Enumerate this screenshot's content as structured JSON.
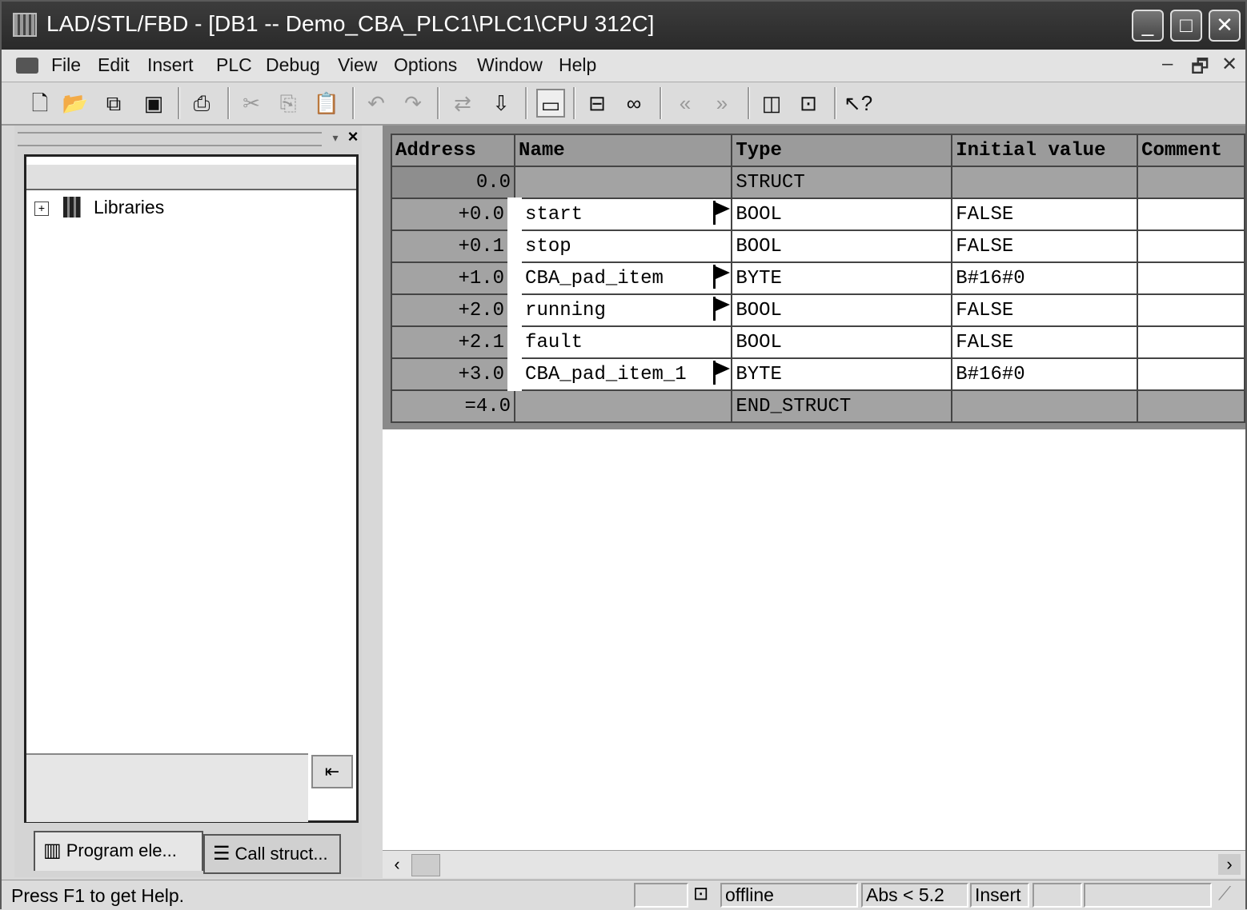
{
  "window": {
    "title": "LAD/STL/FBD  - [DB1 -- Demo_CBA_PLC1\\PLC1\\CPU 312C]",
    "controls": {
      "minimize": "_",
      "maximize": "□",
      "close": "✕"
    }
  },
  "menu": {
    "items": [
      "File",
      "Edit",
      "Insert",
      "PLC",
      "Debug",
      "View",
      "Options",
      "Window",
      "Help"
    ],
    "mdi": {
      "minimize": "–",
      "restore": "🗗",
      "close": "✕"
    }
  },
  "toolbar": {
    "icons": [
      "new-icon",
      "open-icon",
      "accessible-nodes-icon",
      "save-icon",
      "print-icon",
      "cut-icon",
      "copy-icon",
      "paste-icon",
      "undo-icon",
      "redo-icon",
      "load-icon",
      "download-icon",
      "overview-icon",
      "monitor-icon",
      "glasses-icon",
      "prev-icon",
      "next-icon",
      "window-icon",
      "zoom-icon",
      "help-pointer-icon"
    ]
  },
  "left_panel": {
    "tree": [
      {
        "label": "Libraries",
        "expander": "+"
      }
    ],
    "tabs": [
      "Program ele...",
      "Call struct..."
    ]
  },
  "table": {
    "columns": [
      "Address",
      "Name",
      "Type",
      "Initial value",
      "Comment"
    ],
    "rows": [
      {
        "address": "0.0",
        "name": "",
        "type": "STRUCT",
        "initial": "",
        "comment": "",
        "struct": true,
        "flag": false
      },
      {
        "address": "+0.0",
        "name": "start",
        "type": "BOOL",
        "initial": "FALSE",
        "comment": "",
        "struct": false,
        "flag": true
      },
      {
        "address": "+0.1",
        "name": "stop",
        "type": "BOOL",
        "initial": "FALSE",
        "comment": "",
        "struct": false,
        "flag": false
      },
      {
        "address": "+1.0",
        "name": "CBA_pad_item",
        "type": "BYTE",
        "initial": "B#16#0",
        "comment": "",
        "struct": false,
        "flag": true
      },
      {
        "address": "+2.0",
        "name": "running",
        "type": "BOOL",
        "initial": "FALSE",
        "comment": "",
        "struct": false,
        "flag": true
      },
      {
        "address": "+2.1",
        "name": "fault",
        "type": "BOOL",
        "initial": "FALSE",
        "comment": "",
        "struct": false,
        "flag": false
      },
      {
        "address": "+3.0",
        "name": "CBA_pad_item_1",
        "type": "BYTE",
        "initial": "B#16#0",
        "comment": "",
        "struct": false,
        "flag": true
      },
      {
        "address": "=4.0",
        "name": "",
        "type": "END_STRUCT",
        "initial": "",
        "comment": "",
        "struct": true,
        "flag": false
      }
    ]
  },
  "status": {
    "help": "Press F1 to get Help.",
    "mode": "offline",
    "position": "Abs < 5.2",
    "insert": "Insert"
  }
}
